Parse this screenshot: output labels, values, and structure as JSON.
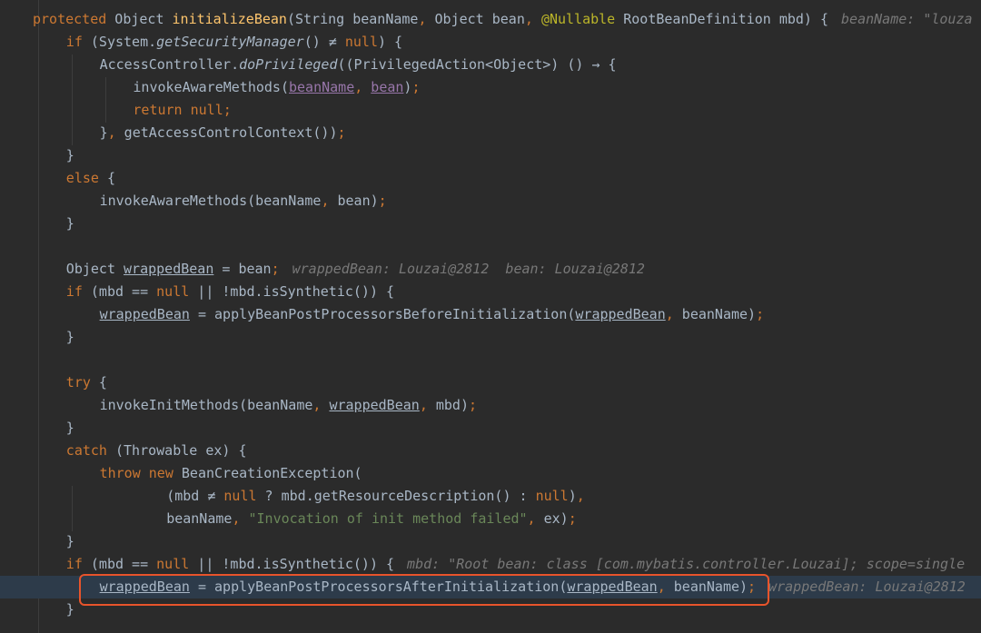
{
  "colors": {
    "background": "#2b2b2b",
    "default_text": "#a9b7c6",
    "keyword": "#cc7832",
    "method_decl": "#ffc66d",
    "annotation": "#bbb529",
    "string": "#6a8759",
    "instance_field": "#9876aa",
    "inline_hint": "#787878",
    "current_line": "#2d3b4a",
    "callout_border": "#e8542b"
  },
  "code": {
    "lines": [
      {
        "indent": 0,
        "tokens": [
          {
            "c": "kw",
            "t": "protected"
          },
          {
            "t": " Object "
          },
          {
            "c": "fn",
            "t": "initializeBean"
          },
          {
            "t": "(String beanName"
          },
          {
            "c": "punc",
            "t": ","
          },
          {
            "t": " Object bean"
          },
          {
            "c": "punc",
            "t": ","
          },
          {
            "t": " "
          },
          {
            "c": "ann",
            "t": "@Nullable"
          },
          {
            "t": " RootBeanDefinition mbd) {"
          }
        ],
        "hint": "beanName: \"louza"
      },
      {
        "indent": 1,
        "tokens": [
          {
            "c": "kw",
            "t": "if"
          },
          {
            "t": " (System."
          },
          {
            "c": "it",
            "t": "getSecurityManager"
          },
          {
            "t": "() ≠ "
          },
          {
            "c": "kw",
            "t": "null"
          },
          {
            "t": ") {"
          }
        ]
      },
      {
        "indent": 2,
        "tokens": [
          {
            "t": "AccessController."
          },
          {
            "c": "it",
            "t": "doPrivileged"
          },
          {
            "t": "((PrivilegedAction<Object>) () → {"
          }
        ]
      },
      {
        "indent": 3,
        "tokens": [
          {
            "t": "invokeAwareMethods("
          },
          {
            "c": "purp ul",
            "t": "beanName"
          },
          {
            "c": "punc",
            "t": ","
          },
          {
            "t": " "
          },
          {
            "c": "purp ul",
            "t": "bean"
          },
          {
            "t": ")"
          },
          {
            "c": "punc",
            "t": ";"
          }
        ]
      },
      {
        "indent": 3,
        "tokens": [
          {
            "c": "kw",
            "t": "return null"
          },
          {
            "c": "punc",
            "t": ";"
          }
        ]
      },
      {
        "indent": 2,
        "tokens": [
          {
            "t": "}"
          },
          {
            "c": "punc",
            "t": ","
          },
          {
            "t": " getAccessControlContext())"
          },
          {
            "c": "punc",
            "t": ";"
          }
        ]
      },
      {
        "indent": 1,
        "tokens": [
          {
            "t": "}"
          }
        ]
      },
      {
        "indent": 1,
        "tokens": [
          {
            "c": "kw",
            "t": "else"
          },
          {
            "t": " {"
          }
        ]
      },
      {
        "indent": 2,
        "tokens": [
          {
            "t": "invokeAwareMethods(beanName"
          },
          {
            "c": "punc",
            "t": ","
          },
          {
            "t": " bean)"
          },
          {
            "c": "punc",
            "t": ";"
          }
        ]
      },
      {
        "indent": 1,
        "tokens": [
          {
            "t": "}"
          }
        ]
      },
      {
        "indent": 0,
        "tokens": []
      },
      {
        "indent": 1,
        "tokens": [
          {
            "t": "Object "
          },
          {
            "c": "ul",
            "t": "wrappedBean"
          },
          {
            "t": " = bean"
          },
          {
            "c": "punc",
            "t": ";"
          }
        ],
        "hint": "wrappedBean: Louzai@2812  bean: Louzai@2812"
      },
      {
        "indent": 1,
        "tokens": [
          {
            "c": "kw",
            "t": "if"
          },
          {
            "t": " (mbd == "
          },
          {
            "c": "kw",
            "t": "null"
          },
          {
            "t": " || !mbd.isSynthetic()) {"
          }
        ]
      },
      {
        "indent": 2,
        "tokens": [
          {
            "c": "ul",
            "t": "wrappedBean"
          },
          {
            "t": " = applyBeanPostProcessorsBeforeInitialization("
          },
          {
            "c": "ul",
            "t": "wrappedBean"
          },
          {
            "c": "punc",
            "t": ","
          },
          {
            "t": " beanName)"
          },
          {
            "c": "punc",
            "t": ";"
          }
        ]
      },
      {
        "indent": 1,
        "tokens": [
          {
            "t": "}"
          }
        ]
      },
      {
        "indent": 0,
        "tokens": []
      },
      {
        "indent": 1,
        "tokens": [
          {
            "c": "kw",
            "t": "try"
          },
          {
            "t": " {"
          }
        ]
      },
      {
        "indent": 2,
        "tokens": [
          {
            "t": "invokeInitMethods(beanName"
          },
          {
            "c": "punc",
            "t": ","
          },
          {
            "t": " "
          },
          {
            "c": "ul",
            "t": "wrappedBean"
          },
          {
            "c": "punc",
            "t": ","
          },
          {
            "t": " mbd)"
          },
          {
            "c": "punc",
            "t": ";"
          }
        ]
      },
      {
        "indent": 1,
        "tokens": [
          {
            "t": "}"
          }
        ]
      },
      {
        "indent": 1,
        "tokens": [
          {
            "c": "kw",
            "t": "catch"
          },
          {
            "t": " (Throwable ex) {"
          }
        ]
      },
      {
        "indent": 2,
        "tokens": [
          {
            "c": "kw",
            "t": "throw new"
          },
          {
            "t": " BeanCreationException("
          }
        ]
      },
      {
        "indent": 4,
        "tokens": [
          {
            "t": "(mbd ≠ "
          },
          {
            "c": "kw",
            "t": "null"
          },
          {
            "t": " ? mbd.getResourceDescription() : "
          },
          {
            "c": "kw",
            "t": "null"
          },
          {
            "t": ")"
          },
          {
            "c": "punc",
            "t": ","
          }
        ]
      },
      {
        "indent": 4,
        "tokens": [
          {
            "t": "beanName"
          },
          {
            "c": "punc",
            "t": ","
          },
          {
            "t": " "
          },
          {
            "c": "str",
            "t": "\"Invocation of init method failed\""
          },
          {
            "c": "punc",
            "t": ","
          },
          {
            "t": " ex)"
          },
          {
            "c": "punc",
            "t": ";"
          }
        ]
      },
      {
        "indent": 1,
        "tokens": [
          {
            "t": "}"
          }
        ]
      },
      {
        "indent": 1,
        "tokens": [
          {
            "c": "kw",
            "t": "if"
          },
          {
            "t": " (mbd == "
          },
          {
            "c": "kw",
            "t": "null"
          },
          {
            "t": " || !mbd.isSynthetic()) {"
          }
        ],
        "hint": "mbd: \"Root bean: class [com.mybatis.controller.Louzai]; scope=single"
      },
      {
        "indent": 2,
        "highlight": true,
        "tokens": [
          {
            "c": "ul",
            "t": "wrappedBean"
          },
          {
            "t": " = applyBeanPostProcessorsAfterInitialization("
          },
          {
            "c": "ul",
            "t": "wrappedBean"
          },
          {
            "c": "punc",
            "t": ","
          },
          {
            "t": " beanName)"
          },
          {
            "c": "punc",
            "t": ";"
          }
        ],
        "hint": "wrappedBean: Louzai@2812"
      },
      {
        "indent": 1,
        "tokens": [
          {
            "t": "}"
          }
        ]
      }
    ]
  }
}
